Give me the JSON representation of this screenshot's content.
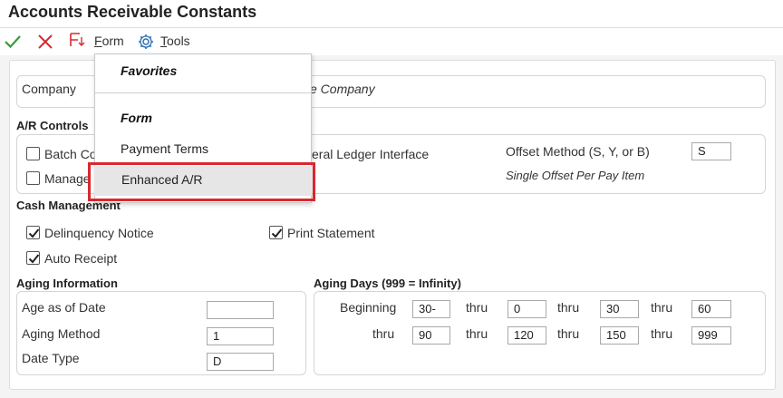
{
  "window": {
    "title": "Accounts Receivable Constants"
  },
  "toolbar": {
    "ok_icon": "check-icon",
    "cancel_icon": "x-icon",
    "form_icon": "form-icon",
    "form_label": "Form",
    "tools_icon": "gear-icon",
    "tools_label": "Tools"
  },
  "company": {
    "label": "Company",
    "value_fragment": "e Company"
  },
  "ar_controls": {
    "header": "A/R Controls",
    "batch_control_fragment": "Batch Co",
    "manager_fragment": "Manage",
    "gl_interface_fragment": "eral Ledger Interface",
    "offset_method_label": "Offset Method (S, Y, or B)",
    "offset_method_value": "S",
    "offset_method_desc": "Single Offset Per Pay Item"
  },
  "cash_management": {
    "header": "Cash Management",
    "delinquency_notice": "Delinquency Notice",
    "print_statement": "Print Statement",
    "auto_receipt": "Auto Receipt"
  },
  "aging_info": {
    "header": "Aging Information",
    "age_as_of_date_label": "Age as of Date",
    "age_as_of_date_value": "",
    "aging_method_label": "Aging Method",
    "aging_method_value": "1",
    "date_type_label": "Date Type",
    "date_type_value": "D"
  },
  "aging_days": {
    "header": "Aging Days (999 = Infinity)",
    "beginning_label": "Beginning",
    "thru_label": "thru",
    "row1": [
      "30-",
      "0",
      "30",
      "60"
    ],
    "row2": [
      "90",
      "120",
      "150",
      "999"
    ]
  },
  "form_menu": {
    "favorites_header": "Favorites",
    "form_header": "Form",
    "items": [
      "Payment Terms",
      "Enhanced A/R"
    ]
  },
  "colors": {
    "check": "#3a9a3a",
    "cancel": "#d9282f",
    "highlight": "#d9282f",
    "link_blue": "#2a6fb0"
  }
}
